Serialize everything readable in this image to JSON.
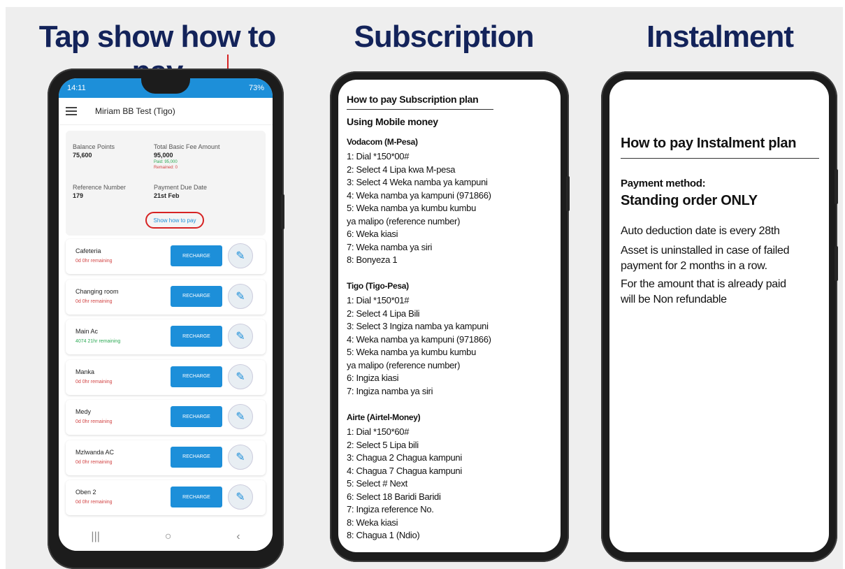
{
  "headings": {
    "tap": "Tap show how to pay",
    "subscription": "Subscription",
    "instalment": "Instalment"
  },
  "app": {
    "time": "14:11",
    "battery": "73%",
    "title": "Miriam BB Test (Tigo)",
    "summary": {
      "balance_label": "Balance Points",
      "balance_value": "75,600",
      "fee_label": "Total Basic Fee Amount",
      "fee_value": "95,000",
      "paid": "Paid: 95,000",
      "remained": "Remained: 0",
      "ref_label": "Reference Number",
      "ref_value": "179",
      "due_label": "Payment Due Date",
      "due_value": "21st Feb",
      "show_how": "Show how to pay"
    },
    "recharge_label": "RECHARGE",
    "rooms": [
      {
        "name": "Cafeteria",
        "remaining": "0d 0hr remaining",
        "status": "red"
      },
      {
        "name": "Changing room",
        "remaining": "0d 0hr remaining",
        "status": "red"
      },
      {
        "name": "Main Ac",
        "remaining": "4074 21hr remaining",
        "status": "green"
      },
      {
        "name": "Manka",
        "remaining": "0d 0hr remaining",
        "status": "red"
      },
      {
        "name": "Medy",
        "remaining": "0d 0hr remaining",
        "status": "red"
      },
      {
        "name": "Mzlwanda AC",
        "remaining": "0d 0hr remaining",
        "status": "red"
      },
      {
        "name": "Oben 2",
        "remaining": "0d 0hr remaining",
        "status": "red"
      }
    ]
  },
  "subscription": {
    "title": "How to pay Subscription plan",
    "using": "Using Mobile money",
    "vodacom": {
      "header": "Vodacom (M-Pesa)",
      "steps": [
        "1: Dial *150*00#",
        "2: Select 4 Lipa kwa M-pesa",
        "3: Select 4 Weka namba ya kampuni",
        "4: Weka namba ya kampuni (971866)",
        "5: Weka namba ya kumbu kumbu",
        "ya malipo (reference number)",
        "6: Weka kiasi",
        "7: Weka namba ya siri",
        "8: Bonyeza 1"
      ]
    },
    "tigo": {
      "header": "Tigo (Tigo-Pesa)",
      "steps": [
        "1: Dial *150*01#",
        "2: Select 4 Lipa Bili",
        "3: Select 3 Ingiza namba ya kampuni",
        "4: Weka namba ya kampuni (971866)",
        "5: Weka namba ya kumbu kumbu",
        "ya malipo (reference number)",
        "6: Ingiza kiasi",
        "7: Ingiza namba ya siri"
      ]
    },
    "airtel": {
      "header": "Airte (Airtel-Money)",
      "steps": [
        "1: Dial *150*60#",
        "2: Select 5 Lipa bili",
        "3: Chagua 2 Chagua kampuni",
        "4: Chagua 7 Chagua kampuni",
        "5: Select # Next",
        "6: Select 18 Baridi Baridi",
        "7: Ingiza reference No.",
        "8: Weka kiasi",
        "8: Chagua 1 (Ndio)"
      ]
    }
  },
  "instalment": {
    "title": "How to pay Instalment plan",
    "method_label": "Payment method:",
    "method_value": "Standing order ONLY",
    "lines": [
      "Auto deduction date is every 28th",
      "Asset is uninstalled in case of failed",
      "payment for 2 months in a row.",
      "For the amount that is already paid",
      "will be Non refundable"
    ]
  },
  "colors": {
    "heading": "#13235a",
    "accent_blue": "#1d8fd9",
    "highlight_red": "#d62222"
  }
}
